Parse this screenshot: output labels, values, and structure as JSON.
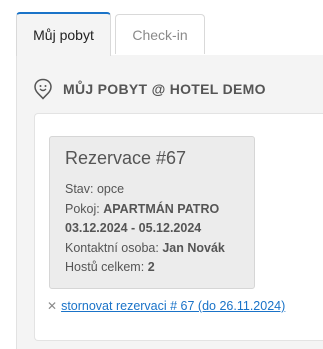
{
  "tabs": [
    {
      "label": "Můj pobyt",
      "active": true
    },
    {
      "label": "Check-in",
      "active": false
    }
  ],
  "panel": {
    "title": "MŮJ POBYT @ HOTEL DEMO",
    "icon": "smile-icon"
  },
  "reservation": {
    "title": "Rezervace #67",
    "status_label": "Stav:",
    "status_value": "opce",
    "room_label": "Pokoj:",
    "room_value": "APARTMÁN PATRO",
    "dates": "03.12.2024 - 05.12.2024",
    "contact_label": "Kontaktní osoba:",
    "contact_value": "Jan Novák",
    "guests_label": "Hostů celkem:",
    "guests_value": "2"
  },
  "cancel": {
    "icon": "close-icon",
    "label": "stornovat rezervaci # 67 (do 26.11.2024)"
  },
  "colors": {
    "accent": "#1a73c8",
    "panel_bg": "#f4f4f4",
    "card_bg": "#ececec",
    "text": "#555555"
  }
}
